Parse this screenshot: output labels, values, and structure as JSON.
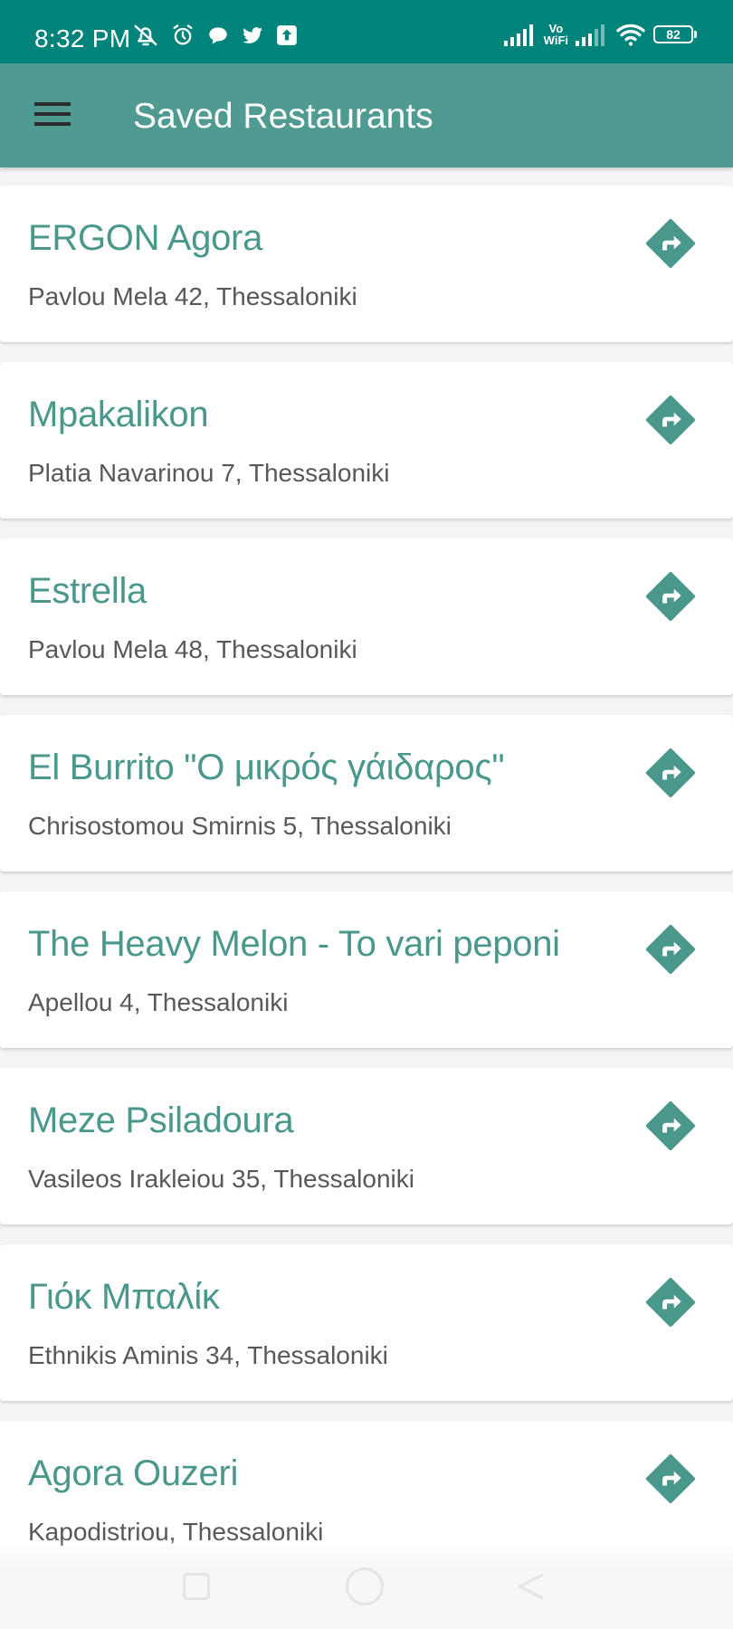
{
  "status_bar": {
    "time": "8:32 PM",
    "left_icons": [
      "bell-off-icon",
      "alarm-icon",
      "chat-bubble-icon",
      "twitter-icon",
      "upload-icon"
    ],
    "vowifi": "Vo\nWiFi",
    "battery": "82"
  },
  "app_bar": {
    "title": "Saved Restaurants",
    "menu_icon": "hamburger-menu-icon"
  },
  "restaurants": [
    {
      "name": "ERGON Agora",
      "address": "Pavlou Mela 42, Thessaloniki"
    },
    {
      "name": "Mpakalikon",
      "address": "Platia Navarinou 7, Thessaloniki"
    },
    {
      "name": "Estrella",
      "address": "Pavlou Mela 48, Thessaloniki"
    },
    {
      "name": "El Burrito \"Ο μικρός γάιδαρος\"",
      "address": "Chrisostomou Smirnis 5, Thessaloniki"
    },
    {
      "name": "The Heavy Melon - To vari peponi",
      "address": "Apellou 4, Thessaloniki"
    },
    {
      "name": "Meze Psiladoura",
      "address": "Vasileos Irakleiou 35, Thessaloniki"
    },
    {
      "name": "Γιόκ Μπαλίκ",
      "address": "Ethnikis Aminis 34, Thessaloniki"
    },
    {
      "name": "Agora Ouzeri",
      "address": "Kapodistriou, Thessaloniki"
    }
  ],
  "item_icon": "directions-icon",
  "colors": {
    "status_bar": "#00837a",
    "app_bar": "#4f9b91",
    "accent": "#4a978c",
    "address_text": "#585858",
    "background": "#f4f4f4"
  }
}
